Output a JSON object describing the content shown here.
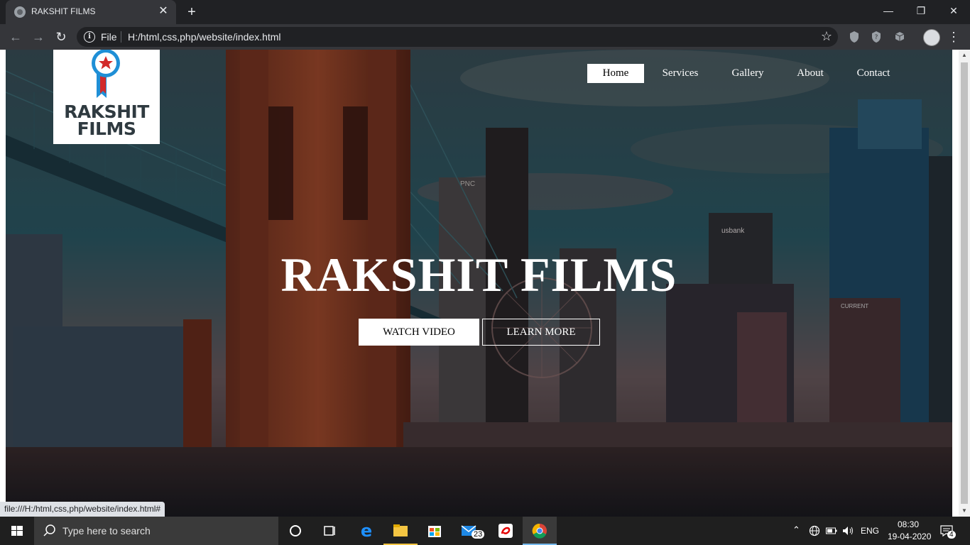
{
  "browser": {
    "tab_title": "RAKSHIT FILMS",
    "tab_close": "✕",
    "new_tab": "+",
    "window_controls": {
      "minimize": "—",
      "restore": "❐",
      "close": "✕"
    },
    "nav": {
      "back": "←",
      "forward": "→",
      "reload": "↻"
    },
    "omnibox": {
      "info": "i",
      "scheme": "File",
      "url": "H:/html,css,php/website/index.html"
    },
    "bookmark_star": "☆",
    "menu": "⋮",
    "status_url": "file:///H:/html,css,php/website/index.html#"
  },
  "site": {
    "logo_text_1": "RAKSHIT",
    "logo_text_2": "FILMS",
    "nav": [
      "Home",
      "Services",
      "Gallery",
      "About",
      "Contact"
    ],
    "active_nav": "Home",
    "hero_title": "RAKSHIT FILMS",
    "buttons": {
      "watch": "WATCH VIDEO",
      "learn": "LEARN MORE"
    },
    "skyline_signs": {
      "pnc": "PNC",
      "usbank": "usbank",
      "current": "CURRENT"
    }
  },
  "taskbar": {
    "search_placeholder": "Type here to search",
    "mail_badge": "23",
    "language": "ENG",
    "time": "08:30",
    "date": "19-04-2020",
    "notification_count": "4"
  },
  "colors": {
    "accent_logo_blue": "#1f8fd6",
    "accent_logo_red": "#d22a2a",
    "hero_dark": "#1c2a33"
  }
}
